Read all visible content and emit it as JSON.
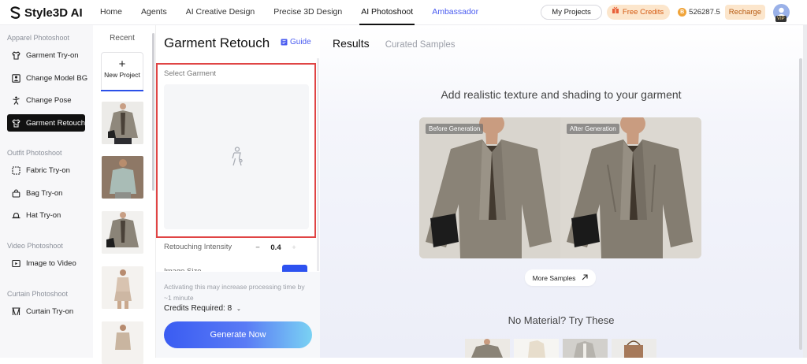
{
  "app": {
    "logo": "Style3D AI"
  },
  "nav": [
    {
      "label": "Home"
    },
    {
      "label": "Agents"
    },
    {
      "label": "AI Creative Design"
    },
    {
      "label": "Precise 3D Design"
    },
    {
      "label": "AI Photoshoot"
    },
    {
      "label": "Ambassador"
    }
  ],
  "topbar": {
    "my_projects": "My Projects",
    "free_credits": "Free Credits",
    "balance": "526287.5",
    "recharge": "Recharge",
    "vip": "VIP"
  },
  "sidebar": {
    "sections": [
      {
        "title": "Apparel Photoshoot",
        "items": [
          "Garment Try-on",
          "Change Model BG",
          "Change Pose",
          "Garment Retouch"
        ]
      },
      {
        "title": "Outfit Photoshoot",
        "items": [
          "Fabric Try-on",
          "Bag Try-on",
          "Hat Try-on"
        ]
      },
      {
        "title": "Video Photoshoot",
        "items": [
          "Image to Video"
        ]
      },
      {
        "title": "Curtain Photoshoot",
        "items": [
          "Curtain Try-on"
        ]
      }
    ],
    "active": "Garment Retouch"
  },
  "recent": {
    "title": "Recent",
    "new_project": "New Project"
  },
  "panel": {
    "title": "Garment Retouch",
    "guide": "Guide",
    "select_garment": "Select Garment",
    "intensity_label": "Retouching Intensity",
    "intensity_value": "0.4",
    "image_size_label": "Image Size",
    "note": "Activating this may increase processing time by ~1 minute",
    "credits_required": "Credits Required: 8",
    "generate": "Generate Now"
  },
  "results": {
    "tab_results": "Results",
    "tab_samples": "Curated Samples",
    "headline": "Add realistic texture and shading to your garment",
    "before": "Before Generation",
    "after": "After Generation",
    "more_samples": "More Samples",
    "no_material": "No Material? Try These"
  },
  "colors": {
    "accent": "#4a5cf0",
    "active_nav_bg": "#111111",
    "generate_start": "#3a5cf2",
    "generate_end": "#7ad2f3",
    "highlight_border": "#e04545"
  }
}
